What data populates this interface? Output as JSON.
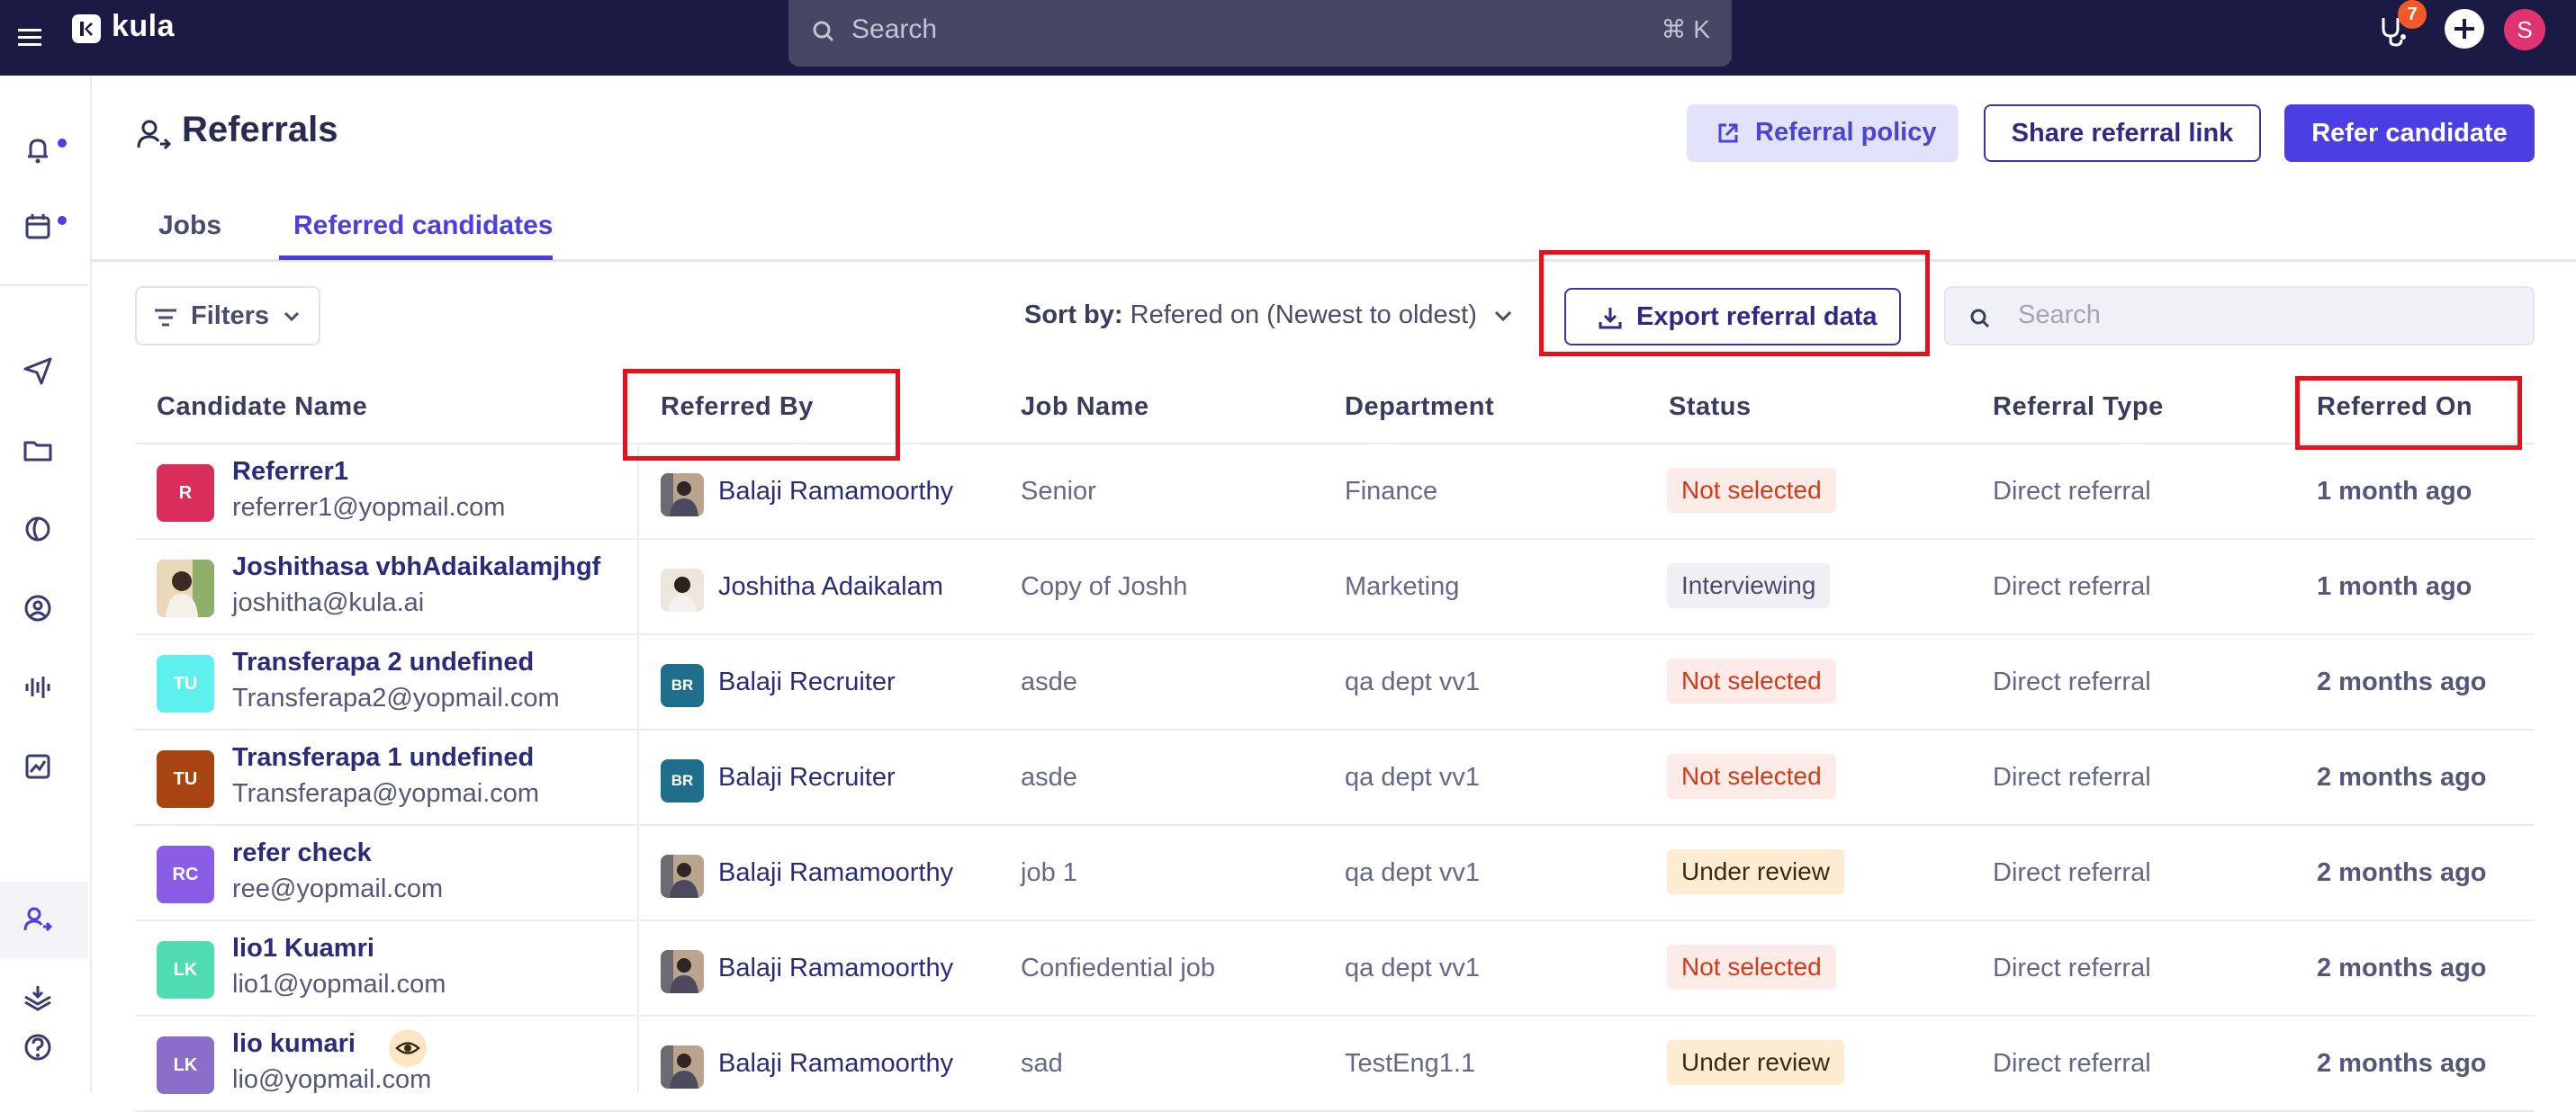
{
  "app": {
    "name": "kula"
  },
  "topbar": {
    "search_placeholder": "Search",
    "search_shortcut": "⌘ K",
    "notification_count": "7",
    "user_initial": "S"
  },
  "page": {
    "title": "Referrals",
    "buttons": {
      "policy": "Referral policy",
      "share": "Share referral link",
      "refer": "Refer candidate"
    },
    "tabs": [
      {
        "label": "Jobs",
        "active": false
      },
      {
        "label": "Referred candidates",
        "active": true
      }
    ]
  },
  "toolbar": {
    "filters_label": "Filters",
    "sort_prefix": "Sort by:",
    "sort_value": "Refered on (Newest to oldest)",
    "export_label": "Export referral data",
    "search_placeholder": "Search"
  },
  "table": {
    "columns": [
      "Candidate Name",
      "Referred By",
      "Job Name",
      "Department",
      "Status",
      "Referral Type",
      "Referred On"
    ],
    "rows": [
      {
        "initials": "R",
        "avatar_color": "#d92d5a",
        "name": "Referrer1",
        "email": "referrer1@yopmail.com",
        "ref_initials": "",
        "ref_avatar": "photo",
        "referred_by": "Balaji Ramamoorthy",
        "job": "Senior",
        "department": "Finance",
        "status": "Not selected",
        "status_kind": "red",
        "type": "Direct referral",
        "referred_on": "1 month ago"
      },
      {
        "initials": "",
        "avatar_color": "#c9a88a",
        "name": "Joshithasa vbhAdaikalamjhgf",
        "email": "joshitha@kula.ai",
        "ref_initials": "",
        "ref_avatar": "photo2",
        "referred_by": "Joshitha Adaikalam",
        "job": "Copy of Joshh",
        "department": "Marketing",
        "status": "Interviewing",
        "status_kind": "grey",
        "type": "Direct referral",
        "referred_on": "1 month ago"
      },
      {
        "initials": "TU",
        "avatar_color": "#5ef0ee",
        "name": "Transferapa 2 undefined",
        "email": "Transferapa2@yopmail.com",
        "ref_initials": "BR",
        "ref_avatar": "#1e6e8c",
        "referred_by": "Balaji Recruiter",
        "job": "asde",
        "department": "qa dept vv1",
        "status": "Not selected",
        "status_kind": "red",
        "type": "Direct referral",
        "referred_on": "2 months ago"
      },
      {
        "initials": "TU",
        "avatar_color": "#a84411",
        "name": "Transferapa 1 undefined",
        "email": "Transferapa@yopmai.com",
        "ref_initials": "BR",
        "ref_avatar": "#1e6e8c",
        "referred_by": "Balaji Recruiter",
        "job": "asde",
        "department": "qa dept vv1",
        "status": "Not selected",
        "status_kind": "red",
        "type": "Direct referral",
        "referred_on": "2 months ago"
      },
      {
        "initials": "RC",
        "avatar_color": "#8b5ce6",
        "name": "refer check",
        "email": "ree@yopmail.com",
        "ref_initials": "",
        "ref_avatar": "photo",
        "referred_by": "Balaji Ramamoorthy",
        "job": "job 1",
        "department": "qa dept vv1",
        "status": "Under review",
        "status_kind": "amber",
        "type": "Direct referral",
        "referred_on": "2 months ago"
      },
      {
        "initials": "LK",
        "avatar_color": "#4fdcb0",
        "name": "lio1 Kuamri",
        "email": "lio1@yopmail.com",
        "ref_initials": "",
        "ref_avatar": "photo",
        "referred_by": "Balaji Ramamoorthy",
        "job": "Confiedential job",
        "department": "qa dept vv1",
        "status": "Not selected",
        "status_kind": "red",
        "type": "Direct referral",
        "referred_on": "2 months ago"
      },
      {
        "initials": "LK",
        "avatar_color": "#8a6ec9",
        "name": "lio kumari",
        "email": "lio@yopmail.com",
        "ref_initials": "",
        "ref_avatar": "photo",
        "referred_by": "Balaji Ramamoorthy",
        "job": "sad",
        "department": "TestEng1.1",
        "status": "Under review",
        "status_kind": "amber",
        "type": "Direct referral",
        "referred_on": "2 months ago"
      }
    ]
  },
  "colors": {
    "topbar": "#1b1a44",
    "accent": "#4b3fe4",
    "annotation": "#e8101c"
  }
}
